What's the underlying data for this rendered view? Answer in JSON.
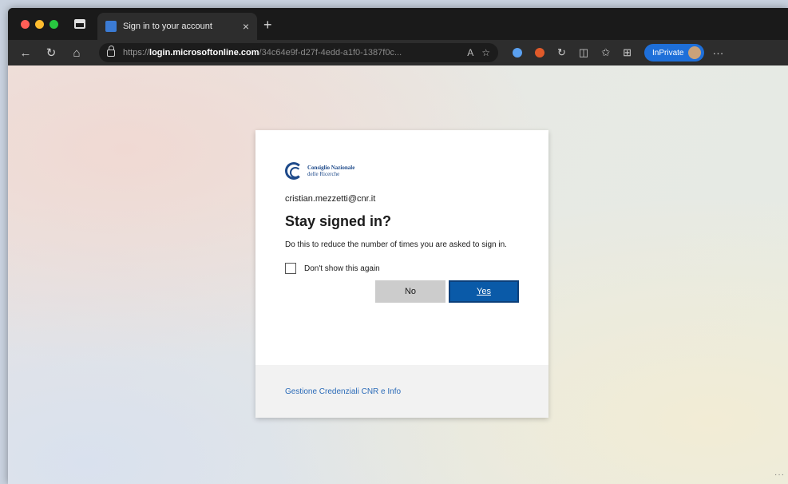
{
  "browser": {
    "tab": {
      "title": "Sign in to your account",
      "close_glyph": "×"
    },
    "new_tab_glyph": "+",
    "nav": {
      "back": "←",
      "refresh": "↻",
      "home": "⌂"
    },
    "address": {
      "scheme": "https://",
      "host": "login.microsoftonline.com",
      "path": "/34c64e9f-d27f-4edd-a1f0-1387f0c..."
    },
    "address_icons": [
      "A",
      "☆"
    ],
    "extension_colors": [
      "#5aa0f0",
      "#e05a2a"
    ],
    "toolbar_glyphs": [
      "↻",
      "◫",
      "✩",
      "⊞"
    ],
    "inprivate_label": "InPrivate",
    "more_glyph": "···"
  },
  "dialog": {
    "logo": {
      "line1": "Consiglio Nazionale",
      "line2": "delle Ricerche"
    },
    "identity": "cristian.mezzetti@cnr.it",
    "heading": "Stay signed in?",
    "description": "Do this to reduce the number of times you are asked to sign in.",
    "checkbox_label": "Don't show this again",
    "no_label": "No",
    "yes_label": "Yes",
    "footer_link": "Gestione Credenziali CNR e Info"
  },
  "status_dots": "···"
}
